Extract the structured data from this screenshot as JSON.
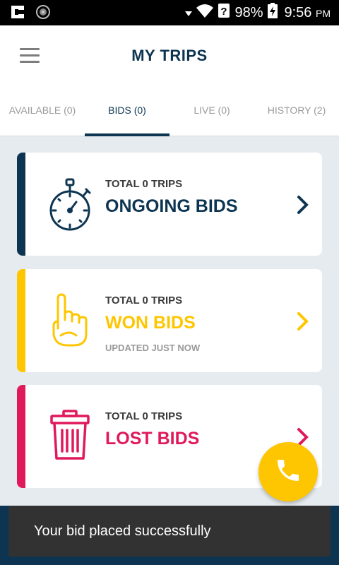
{
  "status_bar": {
    "battery": "98%",
    "time": "9:56",
    "ampm": "PM"
  },
  "header": {
    "title": "MY TRIPS"
  },
  "tabs": [
    {
      "label": "AVAILABLE (0)",
      "active": false
    },
    {
      "label": "BIDS (0)",
      "active": true
    },
    {
      "label": "LIVE (0)",
      "active": false
    },
    {
      "label": "HISTORY (2)",
      "active": false
    }
  ],
  "cards": [
    {
      "total": "TOTAL 0 TRIPS",
      "label": "ONGOING BIDS",
      "color": "#0d3552",
      "icon": "stopwatch-icon"
    },
    {
      "total": "TOTAL 0 TRIPS",
      "label": "WON BIDS",
      "updated": "UPDATED JUST NOW",
      "color": "#fec600",
      "icon": "finger-up-icon"
    },
    {
      "total": "TOTAL 0 TRIPS",
      "label": "LOST BIDS",
      "color": "#e0195b",
      "icon": "trash-icon"
    }
  ],
  "fab": {
    "icon": "phone-icon",
    "color": "#fec600"
  },
  "snackbar": {
    "message": "Your bid placed successfully"
  },
  "colors": {
    "primary": "#0d3552",
    "won": "#fec600",
    "lost": "#e0195b",
    "background": "#e6ebef"
  }
}
